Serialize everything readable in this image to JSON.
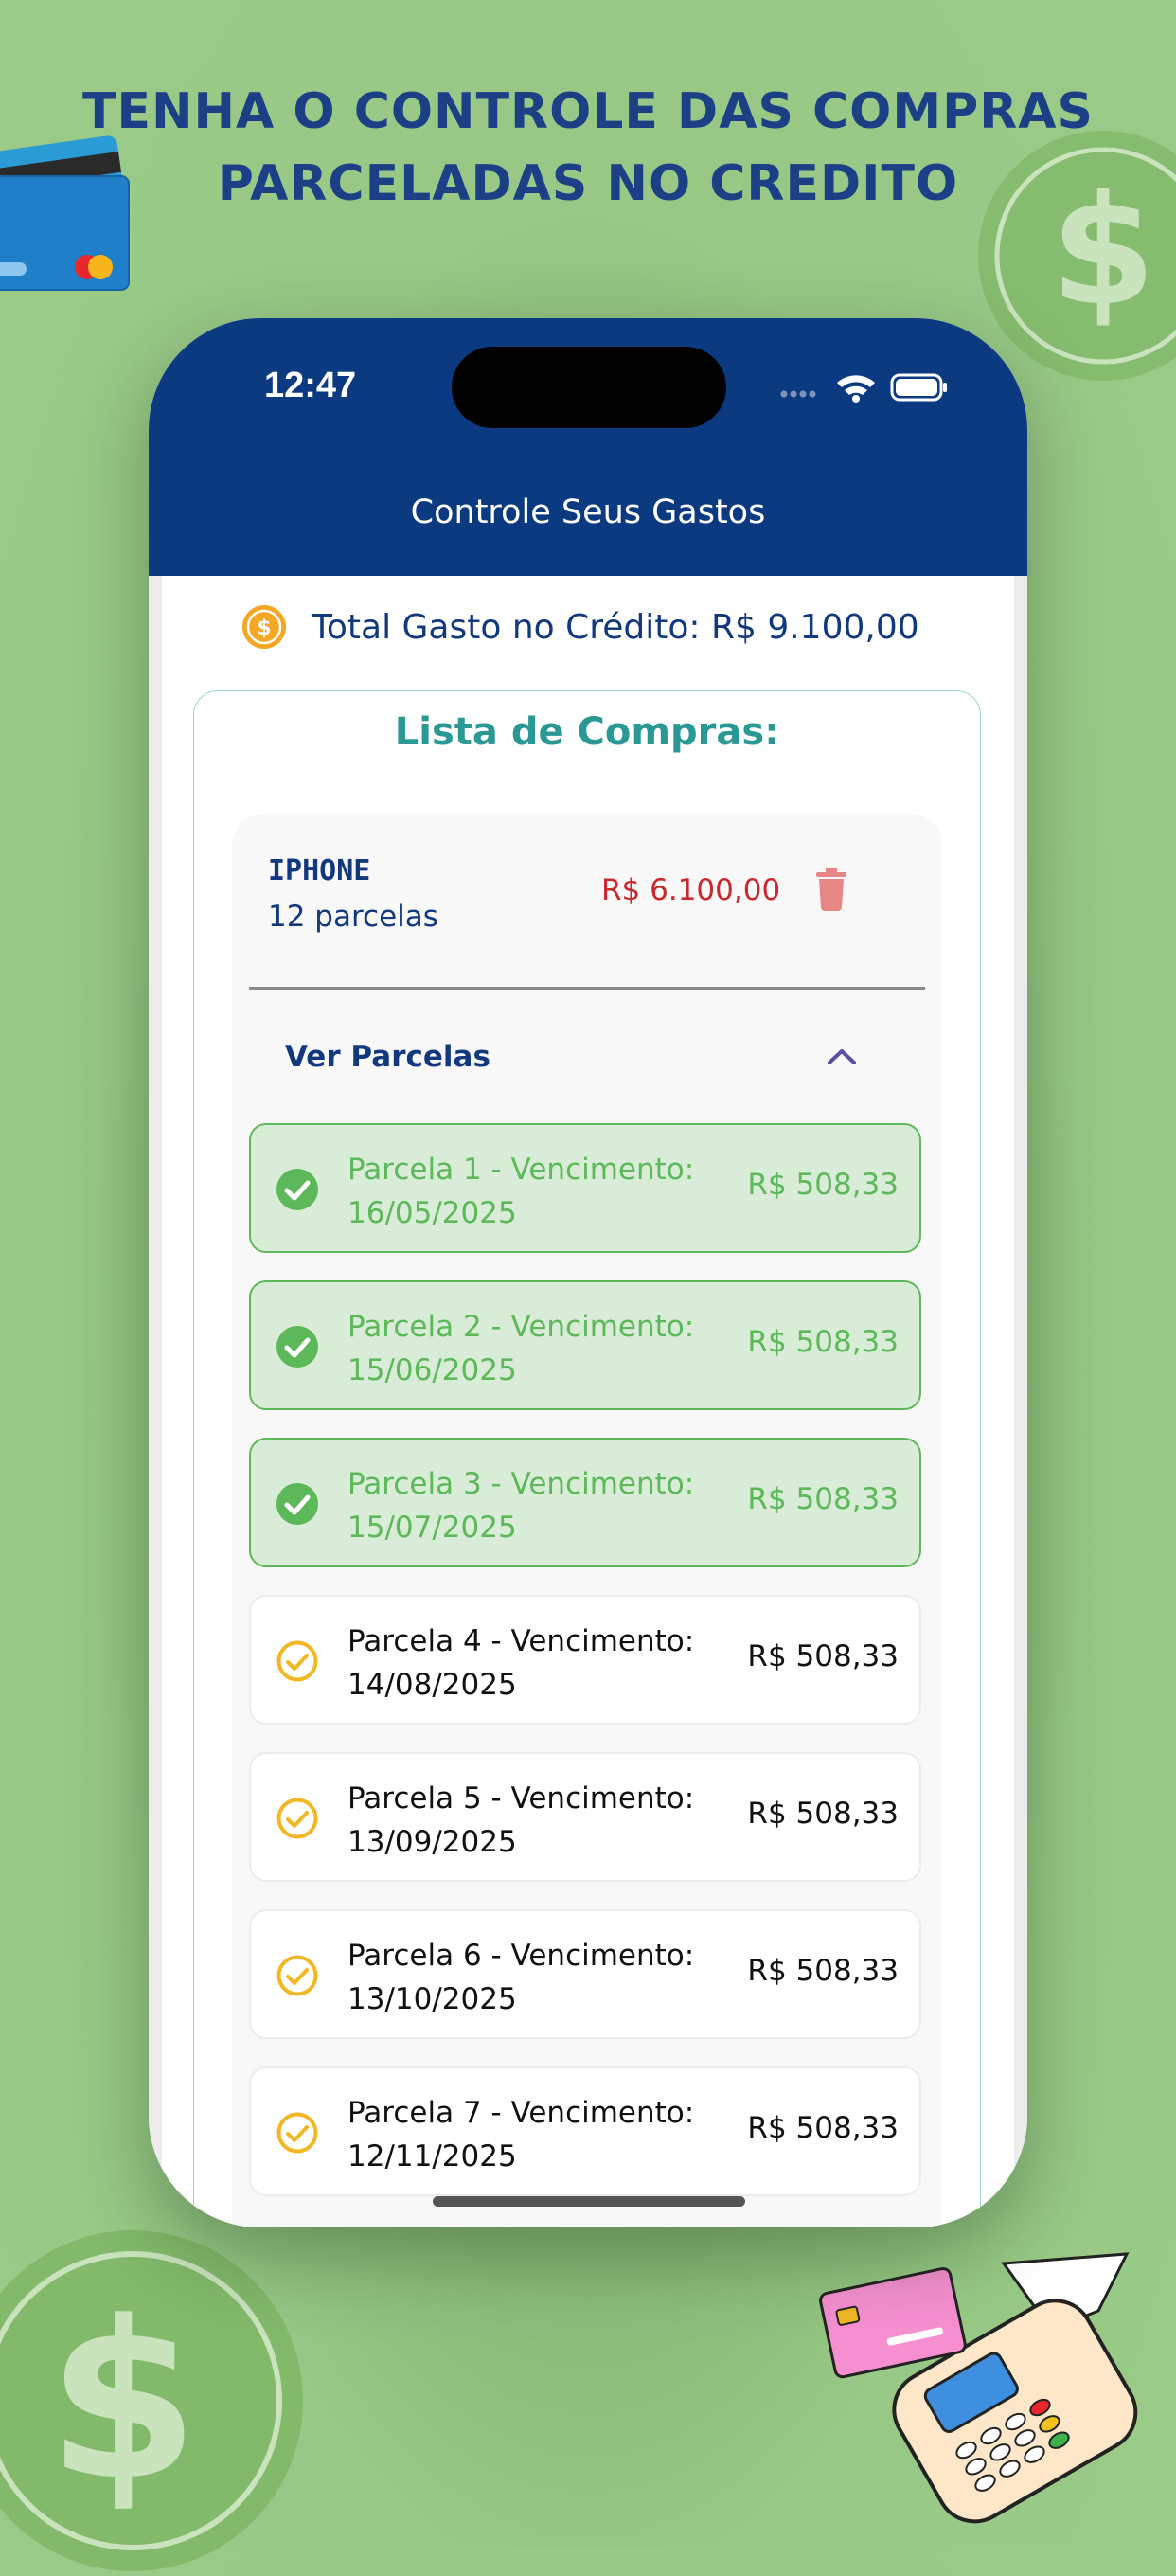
{
  "headline": {
    "line1": "TENHA O CONTROLE DAS COMPRAS",
    "line2": "PARCELADAS NO CREDITO"
  },
  "status_bar": {
    "time": "12:47",
    "icons": [
      "signal-dots-icon",
      "wifi-icon",
      "battery-icon"
    ]
  },
  "app": {
    "title": "Controle Seus Gastos",
    "header_color": "#0b3a80"
  },
  "summary": {
    "icon": "dollar-coin-icon",
    "total_label": "Total Gasto no Crédito: R$ 9.100,00"
  },
  "purchase_list": {
    "title": "Lista de Compras:",
    "items": [
      {
        "name": "IPHONE",
        "installments_text": "12 parcelas",
        "amount": "R$ 6.100,00",
        "delete_icon": "trash-icon",
        "toggle_label": "Ver Parcelas",
        "toggle_icon": "chevron-up-icon",
        "installments": [
          {
            "line1": "Parcela 1 - Vencimento:",
            "line2": "16/05/2025",
            "amount": "R$ 508,33",
            "status": "paid"
          },
          {
            "line1": "Parcela 2 - Vencimento:",
            "line2": "15/06/2025",
            "amount": "R$ 508,33",
            "status": "paid"
          },
          {
            "line1": "Parcela 3 - Vencimento:",
            "line2": "15/07/2025",
            "amount": "R$ 508,33",
            "status": "paid"
          },
          {
            "line1": "Parcela 4 - Vencimento:",
            "line2": "14/08/2025",
            "amount": "R$ 508,33",
            "status": "pending"
          },
          {
            "line1": "Parcela 5 - Vencimento:",
            "line2": "13/09/2025",
            "amount": "R$ 508,33",
            "status": "pending"
          },
          {
            "line1": "Parcela 6 - Vencimento:",
            "line2": "13/10/2025",
            "amount": "R$ 508,33",
            "status": "pending"
          },
          {
            "line1": "Parcela 7 - Vencimento:",
            "line2": "12/11/2025",
            "amount": "R$ 508,33",
            "status": "pending"
          }
        ]
      }
    ]
  },
  "colors": {
    "paid": "#5cb858",
    "pending_icon": "#f2b824",
    "amount_red": "#c9282d",
    "navy": "#12387d",
    "teal_title": "#2a9894",
    "background_green": "#97c885"
  }
}
